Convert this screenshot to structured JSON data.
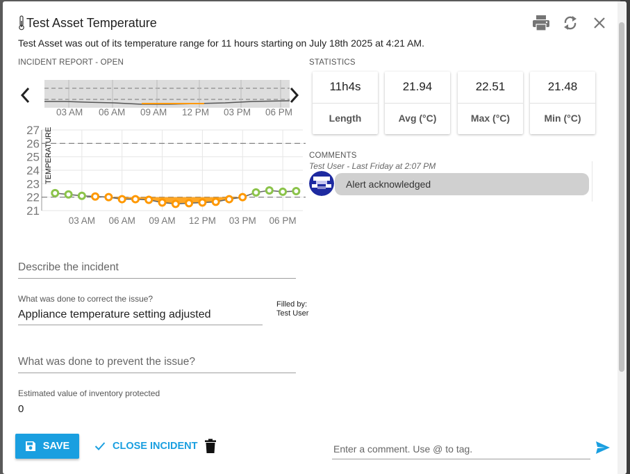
{
  "dialog": {
    "title": "Test Asset Temperature",
    "subtitle": "Test Asset was out of its temperature range for 11 hours starting on July 18th 2025 at 4:21 AM."
  },
  "header_icons": [
    "print-icon",
    "refresh-icon",
    "close-icon"
  ],
  "incident_report": {
    "label": "INCIDENT REPORT - OPEN",
    "overview_ticks": [
      "03 AM",
      "06 AM",
      "09 AM",
      "12 PM",
      "03 PM",
      "06 PM"
    ]
  },
  "chart_data": {
    "type": "line",
    "ylabel": "TEMPERATURE",
    "ylim": [
      21,
      27
    ],
    "yticks": [
      "27",
      "26",
      "25",
      "24",
      "23",
      "22",
      "21"
    ],
    "x_tick_labels": [
      "03 AM",
      "06 AM",
      "09 AM",
      "12 PM",
      "03 PM",
      "06 PM"
    ],
    "reference_lines": [
      26,
      22
    ],
    "series": [
      {
        "points": [
          {
            "hour": 1.0,
            "value": 22.3,
            "status": "normal"
          },
          {
            "hour": 2.0,
            "value": 22.2,
            "status": "normal"
          },
          {
            "hour": 3.0,
            "value": 22.1,
            "status": "normal"
          },
          {
            "hour": 4.0,
            "value": 22.05,
            "status": "out"
          },
          {
            "hour": 5.0,
            "value": 22.0,
            "status": "out"
          },
          {
            "hour": 6.0,
            "value": 21.85,
            "status": "out"
          },
          {
            "hour": 7.0,
            "value": 21.85,
            "status": "out"
          },
          {
            "hour": 8.0,
            "value": 21.8,
            "status": "out"
          },
          {
            "hour": 9.0,
            "value": 21.6,
            "status": "out"
          },
          {
            "hour": 10.0,
            "value": 21.5,
            "status": "out"
          },
          {
            "hour": 11.0,
            "value": 21.55,
            "status": "out"
          },
          {
            "hour": 12.0,
            "value": 21.6,
            "status": "out"
          },
          {
            "hour": 13.0,
            "value": 21.65,
            "status": "out"
          },
          {
            "hour": 14.0,
            "value": 21.85,
            "status": "out"
          },
          {
            "hour": 15.0,
            "value": 22.0,
            "status": "out"
          },
          {
            "hour": 16.0,
            "value": 22.35,
            "status": "normal"
          },
          {
            "hour": 17.0,
            "value": 22.5,
            "status": "normal"
          },
          {
            "hour": 18.0,
            "value": 22.4,
            "status": "normal"
          },
          {
            "hour": 19.0,
            "value": 22.45,
            "status": "normal"
          }
        ]
      }
    ]
  },
  "statistics": {
    "label": "STATISTICS",
    "items": [
      {
        "value": "11h4s",
        "label": "Length"
      },
      {
        "value": "21.94",
        "label": "Avg (°C)"
      },
      {
        "value": "22.51",
        "label": "Max (°C)"
      },
      {
        "value": "21.48",
        "label": "Min (°C)"
      }
    ]
  },
  "comments": {
    "label": "COMMENTS",
    "items": [
      {
        "meta": "Test User - Last Friday at 2:07 PM",
        "text": "Alert acknowledged"
      }
    ]
  },
  "form": {
    "describe_placeholder": "Describe the incident",
    "correct_label": "What was done to correct the issue?",
    "correct_value": "Appliance temperature setting adjusted",
    "filled_by_label": "Filled by:",
    "filled_by_user": "Test User",
    "prevent_placeholder": "What was done to prevent the issue?",
    "inventory_label": "Estimated value of inventory protected",
    "inventory_value": "0"
  },
  "footer": {
    "save_label": "SAVE",
    "close_incident_label": "CLOSE INCIDENT",
    "comment_placeholder": "Enter a comment. Use @ to tag."
  },
  "colors": {
    "accent": "#1a9fe0",
    "normal_point": "#8bc34a",
    "out_of_range_point": "#ff9800"
  }
}
